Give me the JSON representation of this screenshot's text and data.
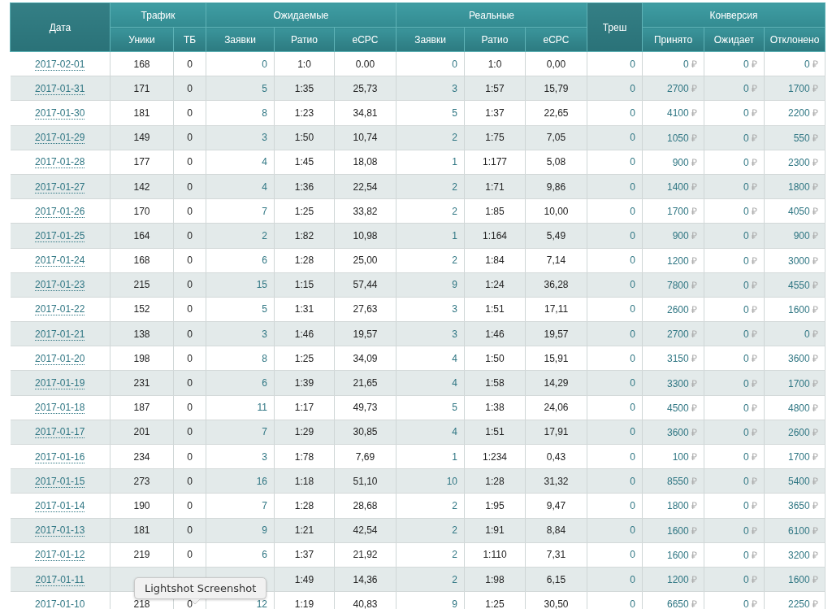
{
  "table": {
    "header_groups": [
      {
        "label": "Дата"
      },
      {
        "label": "Трафик",
        "columns": [
          "Уники",
          "ТБ"
        ]
      },
      {
        "label": "Ожидаемые",
        "columns": [
          "Заявки",
          "Ратио",
          "eCPC"
        ]
      },
      {
        "label": "Реальные",
        "columns": [
          "Заявки",
          "Ратио",
          "eCPC"
        ]
      },
      {
        "label": "Треш"
      },
      {
        "label": "Конверсия",
        "columns": [
          "Принято",
          "Ожидает",
          "Отклонено"
        ]
      }
    ],
    "rows": [
      [
        "2017-02-01",
        "168",
        "0",
        "0",
        "1:0",
        "0.00",
        "0",
        "1:0",
        "0,00",
        "0",
        "0 ₽",
        "0 ₽",
        "0 ₽"
      ],
      [
        "2017-01-31",
        "171",
        "0",
        "5",
        "1:35",
        "25,73",
        "3",
        "1:57",
        "15,79",
        "0",
        "2700 ₽",
        "0 ₽",
        "1700 ₽"
      ],
      [
        "2017-01-30",
        "181",
        "0",
        "8",
        "1:23",
        "34,81",
        "5",
        "1:37",
        "22,65",
        "0",
        "4100 ₽",
        "0 ₽",
        "2200 ₽"
      ],
      [
        "2017-01-29",
        "149",
        "0",
        "3",
        "1:50",
        "10,74",
        "2",
        "1:75",
        "7,05",
        "0",
        "1050 ₽",
        "0 ₽",
        "550 ₽"
      ],
      [
        "2017-01-28",
        "177",
        "0",
        "4",
        "1:45",
        "18,08",
        "1",
        "1:177",
        "5,08",
        "0",
        "900 ₽",
        "0 ₽",
        "2300 ₽"
      ],
      [
        "2017-01-27",
        "142",
        "0",
        "4",
        "1:36",
        "22,54",
        "2",
        "1:71",
        "9,86",
        "0",
        "1400 ₽",
        "0 ₽",
        "1800 ₽"
      ],
      [
        "2017-01-26",
        "170",
        "0",
        "7",
        "1:25",
        "33,82",
        "2",
        "1:85",
        "10,00",
        "0",
        "1700 ₽",
        "0 ₽",
        "4050 ₽"
      ],
      [
        "2017-01-25",
        "164",
        "0",
        "2",
        "1:82",
        "10,98",
        "1",
        "1:164",
        "5,49",
        "0",
        "900 ₽",
        "0 ₽",
        "900 ₽"
      ],
      [
        "2017-01-24",
        "168",
        "0",
        "6",
        "1:28",
        "25,00",
        "2",
        "1:84",
        "7,14",
        "0",
        "1200 ₽",
        "0 ₽",
        "3000 ₽"
      ],
      [
        "2017-01-23",
        "215",
        "0",
        "15",
        "1:15",
        "57,44",
        "9",
        "1:24",
        "36,28",
        "0",
        "7800 ₽",
        "0 ₽",
        "4550 ₽"
      ],
      [
        "2017-01-22",
        "152",
        "0",
        "5",
        "1:31",
        "27,63",
        "3",
        "1:51",
        "17,11",
        "0",
        "2600 ₽",
        "0 ₽",
        "1600 ₽"
      ],
      [
        "2017-01-21",
        "138",
        "0",
        "3",
        "1:46",
        "19,57",
        "3",
        "1:46",
        "19,57",
        "0",
        "2700 ₽",
        "0 ₽",
        "0 ₽"
      ],
      [
        "2017-01-20",
        "198",
        "0",
        "8",
        "1:25",
        "34,09",
        "4",
        "1:50",
        "15,91",
        "0",
        "3150 ₽",
        "0 ₽",
        "3600 ₽"
      ],
      [
        "2017-01-19",
        "231",
        "0",
        "6",
        "1:39",
        "21,65",
        "4",
        "1:58",
        "14,29",
        "0",
        "3300 ₽",
        "0 ₽",
        "1700 ₽"
      ],
      [
        "2017-01-18",
        "187",
        "0",
        "11",
        "1:17",
        "49,73",
        "5",
        "1:38",
        "24,06",
        "0",
        "4500 ₽",
        "0 ₽",
        "4800 ₽"
      ],
      [
        "2017-01-17",
        "201",
        "0",
        "7",
        "1:29",
        "30,85",
        "4",
        "1:51",
        "17,91",
        "0",
        "3600 ₽",
        "0 ₽",
        "2600 ₽"
      ],
      [
        "2017-01-16",
        "234",
        "0",
        "3",
        "1:78",
        "7,69",
        "1",
        "1:234",
        "0,43",
        "0",
        "100 ₽",
        "0 ₽",
        "1700 ₽"
      ],
      [
        "2017-01-15",
        "273",
        "0",
        "16",
        "1:18",
        "51,10",
        "10",
        "1:28",
        "31,32",
        "0",
        "8550 ₽",
        "0 ₽",
        "5400 ₽"
      ],
      [
        "2017-01-14",
        "190",
        "0",
        "7",
        "1:28",
        "28,68",
        "2",
        "1:95",
        "9,47",
        "0",
        "1800 ₽",
        "0 ₽",
        "3650 ₽"
      ],
      [
        "2017-01-13",
        "181",
        "0",
        "9",
        "1:21",
        "42,54",
        "2",
        "1:91",
        "8,84",
        "0",
        "1600 ₽",
        "0 ₽",
        "6100 ₽"
      ],
      [
        "2017-01-12",
        "219",
        "0",
        "6",
        "1:37",
        "21,92",
        "2",
        "1:110",
        "7,31",
        "0",
        "1600 ₽",
        "0 ₽",
        "3200 ₽"
      ],
      [
        "2017-01-11",
        null,
        null,
        null,
        "1:49",
        "14,36",
        "2",
        "1:98",
        "6,15",
        "0",
        "1200 ₽",
        "0 ₽",
        "1600 ₽"
      ],
      [
        "2017-01-10",
        "218",
        "0",
        "12",
        "1:19",
        "40,83",
        "9",
        "1:25",
        "30,50",
        "0",
        "6650 ₽",
        "0 ₽",
        "2250 ₽"
      ]
    ]
  },
  "tooltip": {
    "text": "Lightshot Screenshot"
  }
}
